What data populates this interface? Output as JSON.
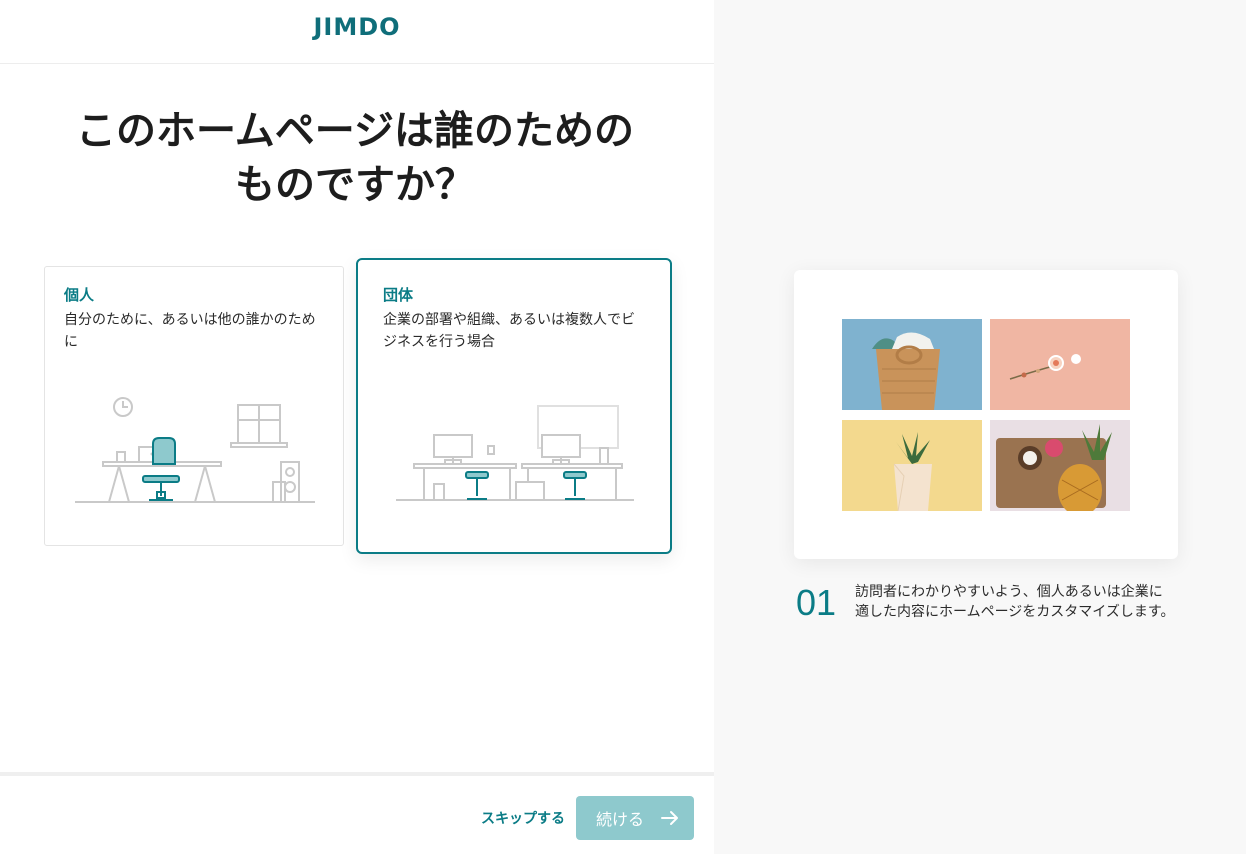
{
  "header": {
    "logo_text": "JIMDO"
  },
  "main": {
    "title": "このホームページは誰のためのものですか？"
  },
  "options": [
    {
      "title": "個人",
      "description": "自分のために、あるいは他の誰かのために"
    },
    {
      "title": "団体",
      "description": "企業の部署や組織、あるいは複数人でビジネスを行う場合"
    }
  ],
  "footer": {
    "skip_label": "スキップする",
    "continue_label": "続ける"
  },
  "preview": {
    "step_number": "01",
    "step_description": "訪問者にわかりやすいよう、個人あるいは企業に適した内容にホームページをカスタマイズします。"
  },
  "colors": {
    "accent": "#0b7c86",
    "button_disabled": "#8ec9cd",
    "right_bg": "#f8f8f8"
  },
  "icons": {
    "continue": "arrow-right-icon"
  }
}
